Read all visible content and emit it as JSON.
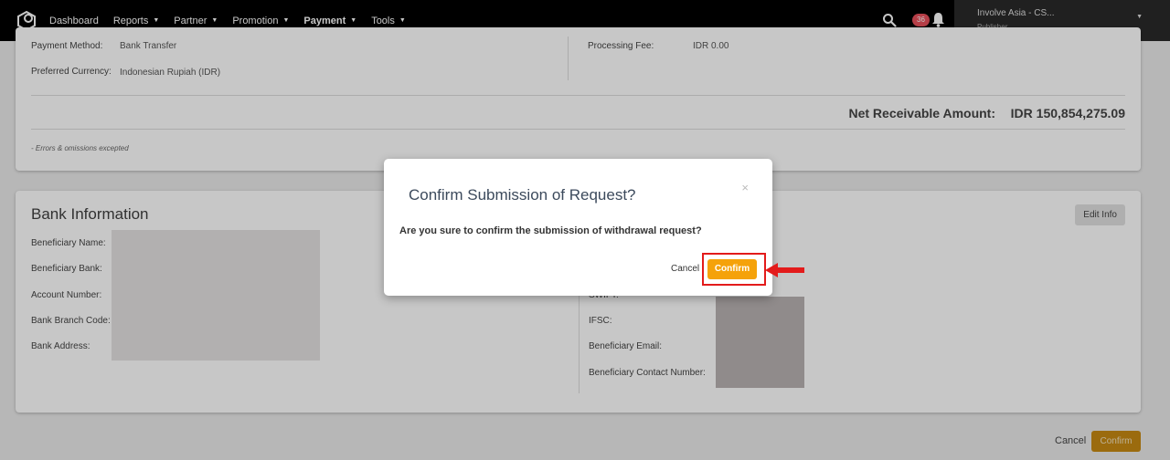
{
  "nav": {
    "items": [
      {
        "label": "Dashboard",
        "caret": false,
        "active": false
      },
      {
        "label": "Reports",
        "caret": true,
        "active": false
      },
      {
        "label": "Partner",
        "caret": true,
        "active": false
      },
      {
        "label": "Promotion",
        "caret": true,
        "active": false
      },
      {
        "label": "Payment",
        "caret": true,
        "active": true
      },
      {
        "label": "Tools",
        "caret": true,
        "active": false
      }
    ],
    "notification_count": "36",
    "account_name": "Involve Asia - CS...",
    "account_role": "Publisher"
  },
  "payment_summary": {
    "payment_method_label": "Payment Method:",
    "payment_method_value": "Bank Transfer",
    "preferred_currency_label": "Preferred Currency:",
    "preferred_currency_value": "Indonesian Rupiah (IDR)",
    "processing_fee_label": "Processing Fee:",
    "processing_fee_value": "IDR 0.00",
    "net_receivable_label": "Net Receivable Amount:",
    "net_receivable_value": "IDR 150,854,275.09",
    "note": "- Errors & omissions excepted"
  },
  "bank_info": {
    "title": "Bank Information",
    "edit_button": "Edit Info",
    "left_fields": [
      "Beneficiary Name:",
      "Beneficiary Bank:",
      "Account Number:",
      "Bank Branch Code:",
      "Bank Address:"
    ],
    "right_fields": [
      "SWIFT:",
      "IFSC:",
      "Beneficiary Email:",
      "Beneficiary Contact Number:"
    ]
  },
  "footer": {
    "cancel": "Cancel",
    "confirm": "Confirm"
  },
  "modal": {
    "title": "Confirm Submission of Request?",
    "close": "×",
    "message": "Are you sure to confirm the submission of withdrawal request?",
    "cancel": "Cancel",
    "confirm": "Confirm"
  },
  "colors": {
    "accent": "#f5a20a",
    "highlight": "#e31b1b",
    "badge": "#e8505b"
  }
}
